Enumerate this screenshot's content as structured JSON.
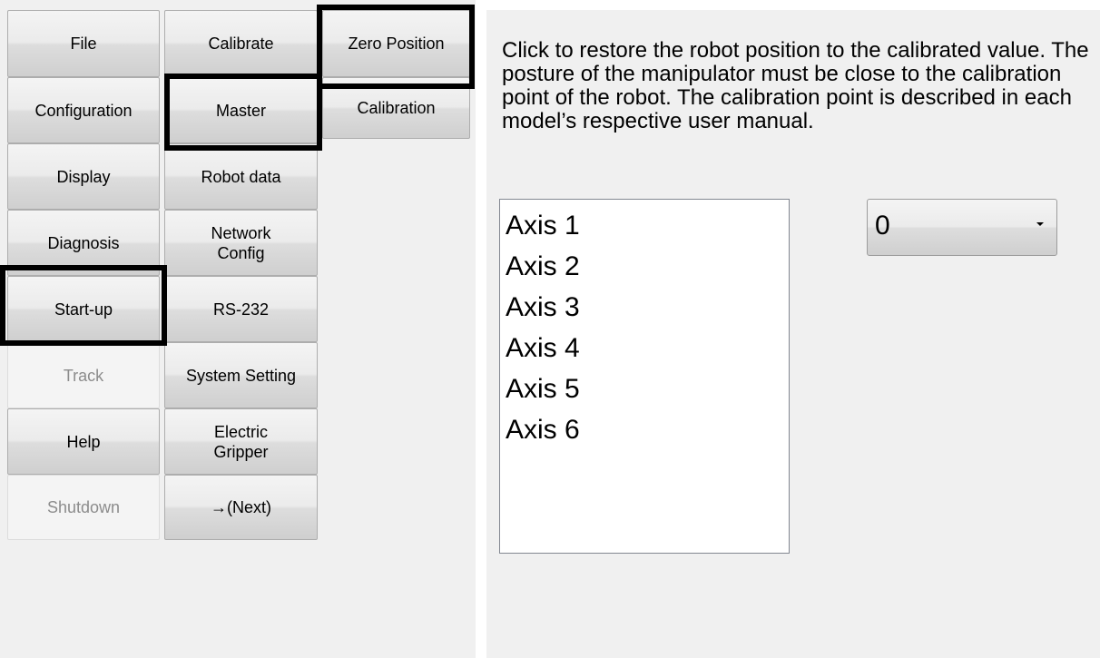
{
  "menu": {
    "column1": [
      {
        "label": "File",
        "enabled": true
      },
      {
        "label": "Configuration",
        "enabled": true
      },
      {
        "label": "Display",
        "enabled": true
      },
      {
        "label": "Diagnosis",
        "enabled": true
      },
      {
        "label": "Start-up",
        "enabled": true,
        "highlighted": true
      },
      {
        "label": "Track",
        "enabled": false
      },
      {
        "label": "Help",
        "enabled": true
      },
      {
        "label": "Shutdown",
        "enabled": false
      }
    ],
    "column2": [
      {
        "label": "Calibrate",
        "enabled": true
      },
      {
        "label": "Master",
        "enabled": true,
        "highlighted": true
      },
      {
        "label": "Robot data",
        "enabled": true
      },
      {
        "label": "Network\nConfig",
        "enabled": true
      },
      {
        "label": "RS-232",
        "enabled": true
      },
      {
        "label": "System Setting",
        "enabled": true
      },
      {
        "label": "Electric\nGripper",
        "enabled": true
      },
      {
        "label": "→(Next)",
        "enabled": true
      }
    ],
    "column3": [
      {
        "label": "Zero Position",
        "enabled": true,
        "highlighted": true
      },
      {
        "label": "Calibration",
        "enabled": true
      }
    ]
  },
  "content": {
    "description": "Click to restore the robot position to the calibrated value. The posture of the manipulator must be close to the calibration point of the robot. The calibration point is described in each model’s respective user manual.",
    "axes": [
      "Axis 1",
      "Axis 2",
      "Axis 3",
      "Axis 4",
      "Axis 5",
      "Axis 6"
    ],
    "value_select": {
      "selected": "0"
    }
  },
  "colors": {
    "panel_background": "#f0f0f0",
    "highlight_border": "#000000",
    "disabled_text": "#8c8c8c"
  },
  "icons": {
    "dropdown": "chevron-down-icon"
  }
}
